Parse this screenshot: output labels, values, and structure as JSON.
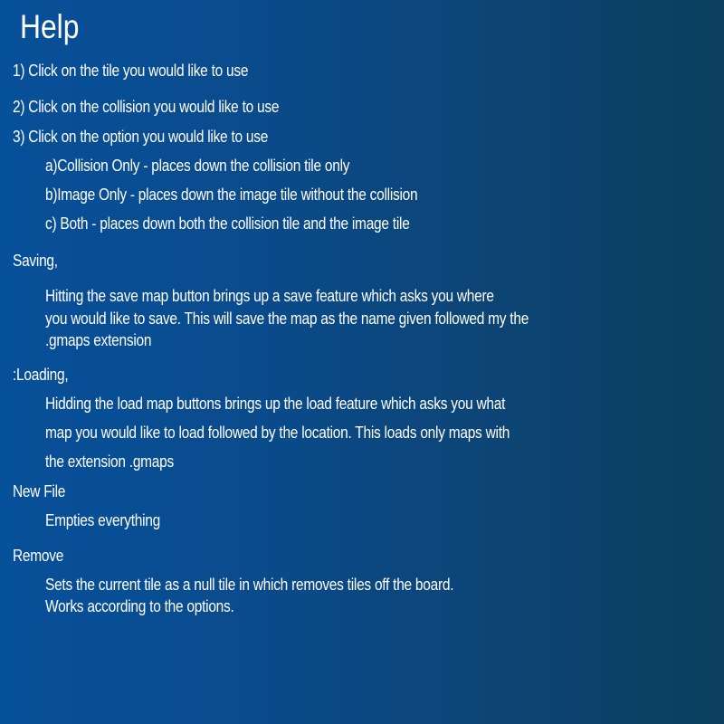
{
  "help": {
    "title": "Help",
    "steps": [
      "1) Click on the tile you would like to use",
      "2) Click on the collision you would like to use",
      "3) Click on the option you would like to use"
    ],
    "options": [
      "a)Collision Only - places down the collision tile only",
      "b)Image Only - places down the image tile without the collision",
      "c) Both - places down both the collision tile and the image tile"
    ],
    "saving": {
      "heading": "Saving,",
      "lines": [
        "Hitting the save map button brings up a save feature which asks you where",
        "you would like to save. This will save the map as the name given followed my the",
        ".gmaps extension"
      ]
    },
    "loading": {
      "heading": ":Loading,",
      "lines": [
        "Hidding the load map buttons brings up the load feature which asks you what",
        "map you would like to load followed by the location. This loads only maps with",
        "the extension .gmaps"
      ]
    },
    "new_file": {
      "heading": "New File",
      "lines": [
        "Empties everything"
      ]
    },
    "remove": {
      "heading": "Remove",
      "lines": [
        "Sets the current tile as a null tile in which removes tiles off the board.",
        "Works according to the options."
      ]
    }
  }
}
